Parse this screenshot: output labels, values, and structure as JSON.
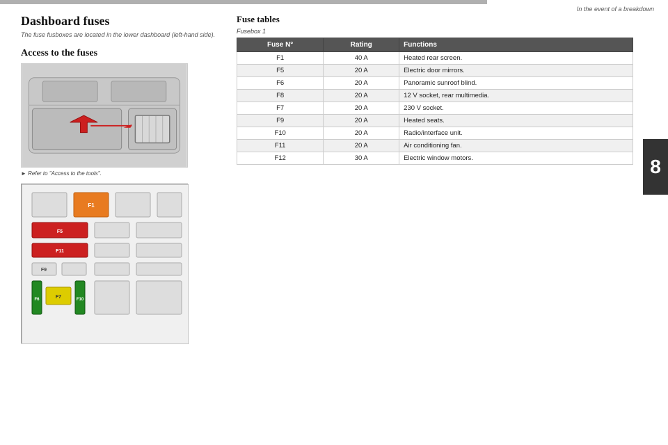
{
  "header": {
    "top_bar_visible": true,
    "right_text": "In the event of a breakdown",
    "chapter_number": "8"
  },
  "page": {
    "title": "Dashboard fuses",
    "subtitle": "The fuse fusboxes are located in the lower dashboard (left-hand side).",
    "left_section": {
      "access_title": "Access to the fuses",
      "refer_label": "Refer to \"Access to the tools\"."
    },
    "right_section": {
      "fuse_table_title": "Fuse tables",
      "fusebox_label": "Fusebox 1",
      "table": {
        "headers": [
          "Fuse N°",
          "Rating",
          "Functions"
        ],
        "rows": [
          {
            "fuse": "F1",
            "rating": "40 A",
            "function": "Heated rear screen."
          },
          {
            "fuse": "F5",
            "rating": "20 A",
            "function": "Electric door mirrors."
          },
          {
            "fuse": "F6",
            "rating": "20 A",
            "function": "Panoramic sunroof blind."
          },
          {
            "fuse": "F8",
            "rating": "20 A",
            "function": "12 V socket, rear multimedia."
          },
          {
            "fuse": "F7",
            "rating": "20 A",
            "function": "230 V socket."
          },
          {
            "fuse": "F9",
            "rating": "20 A",
            "function": "Heated seats."
          },
          {
            "fuse": "F10",
            "rating": "20 A",
            "function": "Radio/interface unit."
          },
          {
            "fuse": "F11",
            "rating": "20 A",
            "function": "Air conditioning fan."
          },
          {
            "fuse": "F12",
            "rating": "30 A",
            "function": "Electric window motors."
          }
        ]
      }
    }
  },
  "fusebox_diagram": {
    "fuses": [
      {
        "id": "F1",
        "color": "orange",
        "row": 1,
        "col": 2,
        "w": 40,
        "h": 28
      },
      {
        "id": "F5",
        "color": "red",
        "row": 2,
        "col": 1,
        "w": 55,
        "h": 18
      },
      {
        "id": "F11",
        "color": "red",
        "row": 3,
        "col": 1,
        "w": 55,
        "h": 18
      },
      {
        "id": "F9",
        "color": "gray",
        "row": 4,
        "col": 1,
        "w": 30,
        "h": 18
      },
      {
        "id": "F6",
        "color": "green",
        "row": 5,
        "col": 1,
        "w": 12,
        "h": 40
      },
      {
        "id": "F7",
        "color": "yellow",
        "row": 5,
        "col": 2,
        "w": 30,
        "h": 20
      },
      {
        "id": "F10",
        "color": "green",
        "row": 5,
        "col": 3,
        "w": 12,
        "h": 40
      }
    ]
  }
}
